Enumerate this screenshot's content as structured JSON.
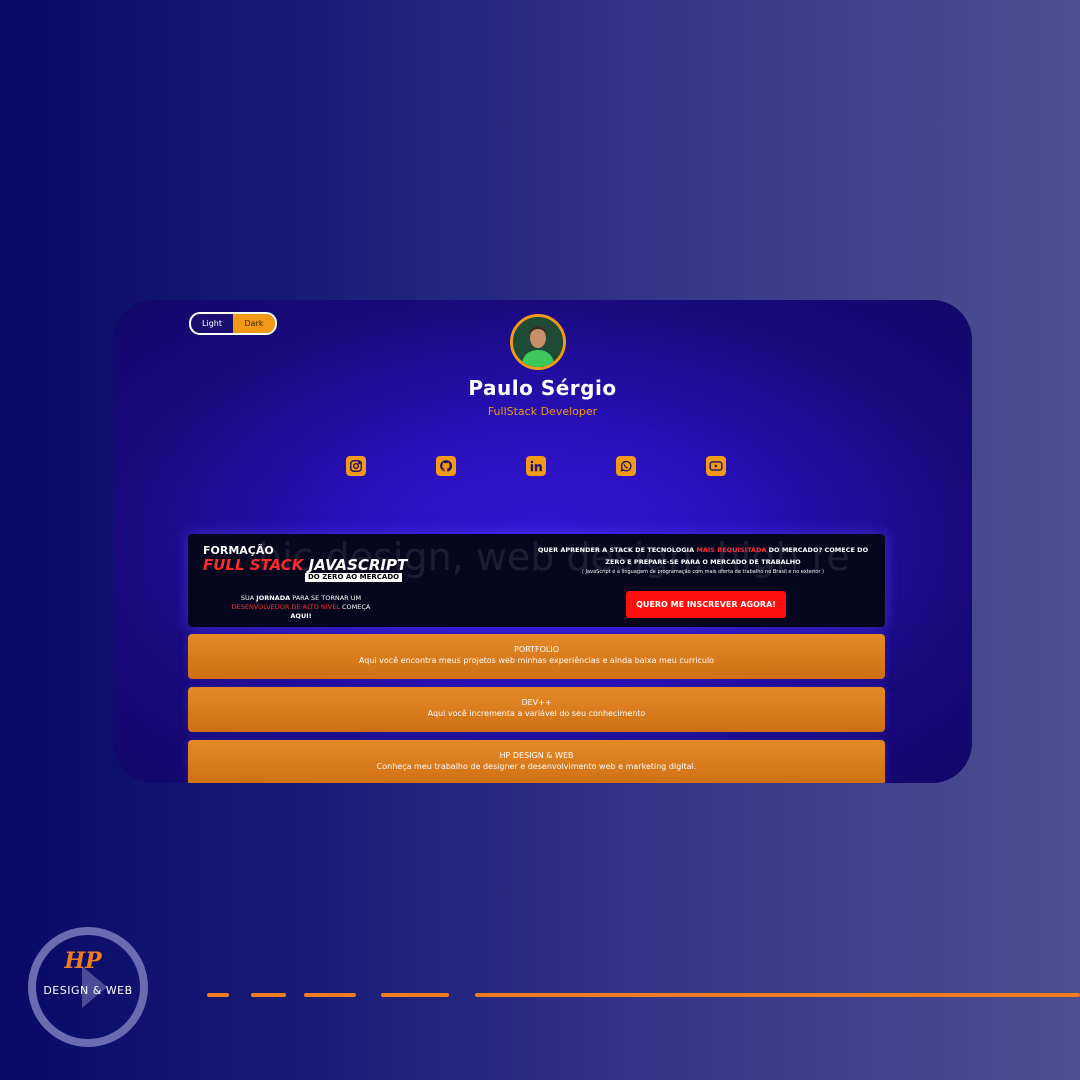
{
  "profile": {
    "name": "Paulo Sérgio",
    "role": "FullStack Developer"
  },
  "theme_toggle": {
    "light": "Light",
    "dark": "Dark",
    "selected": "Dark"
  },
  "socials": [
    "instagram-icon",
    "github-icon",
    "linkedin-icon",
    "whatsapp-icon",
    "youtube-icon"
  ],
  "banner": {
    "formacao": "FORMAÇÃO",
    "full_stack": "FULL STACK",
    "javascript": "JAVASCRIPT",
    "zero": "DO ZERO AO MERCADO",
    "jornada_1": "SUA",
    "jornada_2": "JORNADA",
    "jornada_3": "PARA SE TORNAR UM",
    "jornada_4": "DESENVOLVEDOR DE ALTO NÍVEL",
    "jornada_5": "COMEÇA",
    "jornada_6": "AQUI!",
    "question_1": "QUER APRENDER A STACK DE TECNOLOGIA",
    "question_hl": "MAIS REQUISITADA",
    "question_2": "DO MERCADO? COMECE DO ZERO E PREPARE-SE PARA O MERCADO DE TRABALHO",
    "js_note": "( JavaScript é a linguagem de programação com mais oferta de trabalho no Brasil e no exterior )",
    "cta": "QUERO ME INSCREVER AGORA!",
    "bg_text": "hic design, web design, high re"
  },
  "links": [
    {
      "title": "PORTFOLIO",
      "desc": "Aqui você encontra meus projetos web minhas experiências e ainda baixa meu curriculo"
    },
    {
      "title": "DEV++",
      "desc": "Aqui você incrementa a variável do seu conhecimento"
    },
    {
      "title": "HP DESIGN & WEB",
      "desc": "Conheça meu trabalho de designer e desenvolvimento web e marketing digital."
    }
  ],
  "brand": {
    "logo_text": "DESIGN & WEB",
    "monogram": "HP"
  },
  "colors": {
    "accent": "#f29a16",
    "cta": "#ff0e0e",
    "card": "#2810b8"
  }
}
